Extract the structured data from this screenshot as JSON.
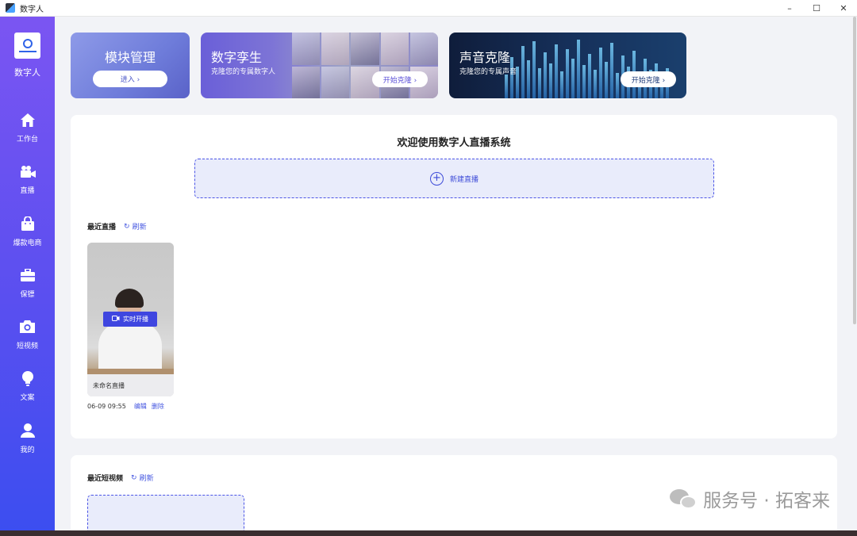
{
  "window": {
    "title": "数字人",
    "controls": [
      "–",
      "☐",
      "✕"
    ]
  },
  "sidebar": {
    "brand": "数字人",
    "items": [
      {
        "label": "工作台",
        "icon": "home-icon"
      },
      {
        "label": "直播",
        "icon": "video-camera-icon"
      },
      {
        "label": "爆款电商",
        "icon": "shopping-bag-icon"
      },
      {
        "label": "保镖",
        "icon": "briefcase-icon"
      },
      {
        "label": "短视频",
        "icon": "camera-icon"
      },
      {
        "label": "文案",
        "icon": "lightbulb-icon"
      },
      {
        "label": "我的",
        "icon": "user-icon"
      }
    ]
  },
  "banners": {
    "module": {
      "title": "模块管理",
      "button": "进入 ›"
    },
    "twin": {
      "title": "数字孪生",
      "subtitle": "克隆您的专属数字人",
      "button": "开始克隆 ›"
    },
    "voice": {
      "title": "声音克隆",
      "subtitle": "克隆您的专属声音",
      "button": "开始克隆 ›"
    }
  },
  "main": {
    "welcome": "欢迎使用数字人直播系统",
    "new_live": "新建直播",
    "recent_live": {
      "title": "最近直播",
      "refresh": "刷新"
    },
    "live_card": {
      "tag": "实时开播",
      "name": "未命名直播",
      "date": "06-09 09:55",
      "edit": "编辑",
      "delete": "删除"
    },
    "recent_video": {
      "title": "最近短视频",
      "refresh": "刷新"
    }
  },
  "watermark": {
    "text": "服务号 · 拓客来"
  },
  "colors": {
    "accent": "#4456e0",
    "sidebar_top": "#7b55f2",
    "sidebar_bottom": "#3c4ef0"
  }
}
